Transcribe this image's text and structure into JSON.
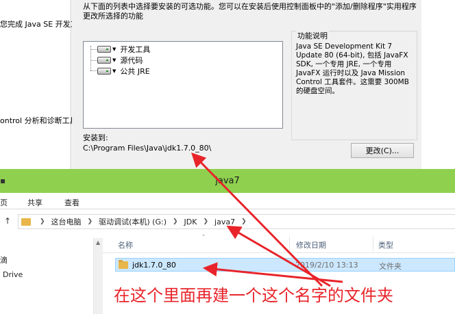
{
  "installer": {
    "left_snippets": [
      "您完成 Java SE 开发工",
      "ontrol 分析和诊断工具"
    ],
    "description": "从下面的列表中选择要安装的可选功能。您可以在安装后使用控制面板中的\"添加/删除程序\"实用程序更改所选择的功能",
    "features": [
      "开发工具",
      "源代码",
      "公共 JRE"
    ],
    "info_title": "功能说明",
    "info_text": "Java SE Development Kit 7 Update 80 (64-bit), 包括 JavaFX SDK, 一个专用 JRE, 一个专用 JavaFX 运行时以及 Java Mission Control 工具套件。这需要 300MB 的硬盘空间。",
    "install_to_label": "安装到:",
    "install_path": "C:\\Program Files\\Java\\jdk1.7.0_80\\",
    "change_button": "更改(C)..."
  },
  "explorer": {
    "title": "java7",
    "ribbon_tabs": [
      "页",
      "共享",
      "查看"
    ],
    "breadcrumb": [
      "这台电脑",
      "驱动调试(本机) (G:)",
      "JDK",
      "java7"
    ],
    "nav_items": [
      "滴",
      "Drive"
    ],
    "columns": [
      "名称",
      "修改日期",
      "类型"
    ],
    "rows": [
      {
        "name": "jdk1.7.0_80",
        "date": "2019/2/10 13:13",
        "type": "文件夹"
      }
    ]
  },
  "annotation": {
    "text": "在这个里面再建一个这个名字的文件夹",
    "color": "#e8242a"
  },
  "colors": {
    "titlebar": "#8fd14f",
    "selection": "#cce8ff"
  }
}
